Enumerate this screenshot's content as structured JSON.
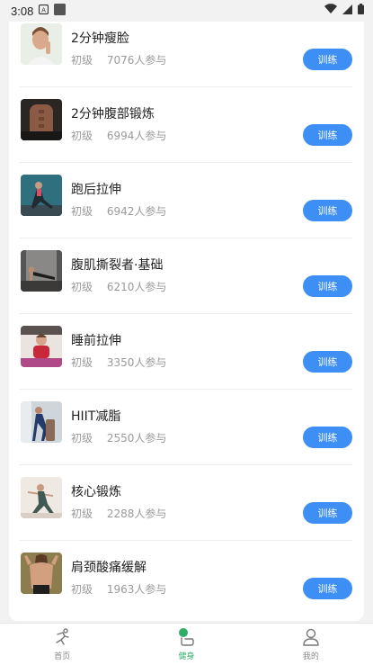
{
  "status_bar": {
    "time": "3:08"
  },
  "colors": {
    "button": "#3d8ef5",
    "active_tab": "#2fae6a",
    "inactive_tab": "#8a8a8a"
  },
  "courses": [
    {
      "title": "2分钟瘦脸",
      "level": "初级",
      "participants": "7076人参与",
      "button": "训练",
      "thumb_icon": "woman-face-photo"
    },
    {
      "title": "2分钟腹部锻炼",
      "level": "初级",
      "participants": "6994人参与",
      "button": "训练",
      "thumb_icon": "abs-photo"
    },
    {
      "title": "跑后拉伸",
      "level": "初级",
      "participants": "6942人参与",
      "button": "训练",
      "thumb_icon": "lunge-stretch-photo"
    },
    {
      "title": "腹肌撕裂者·基础",
      "level": "初级",
      "participants": "6210人参与",
      "button": "训练",
      "thumb_icon": "plank-photo"
    },
    {
      "title": "睡前拉伸",
      "level": "初级",
      "participants": "3350人参与",
      "button": "训练",
      "thumb_icon": "yoga-mat-photo"
    },
    {
      "title": "HIIT减脂",
      "level": "初级",
      "participants": "2550人参与",
      "button": "训练",
      "thumb_icon": "hiit-photo"
    },
    {
      "title": "核心锻炼",
      "level": "初级",
      "participants": "2288人参与",
      "button": "训练",
      "thumb_icon": "core-pose-photo"
    },
    {
      "title": "肩颈酸痛缓解",
      "level": "初级",
      "participants": "1963人参与",
      "button": "训练",
      "thumb_icon": "back-neck-photo"
    }
  ],
  "tabs": [
    {
      "label": "首页",
      "icon": "runner-icon",
      "active": false
    },
    {
      "label": "健身",
      "icon": "fitness-icon",
      "active": true
    },
    {
      "label": "我的",
      "icon": "person-icon",
      "active": false
    }
  ]
}
